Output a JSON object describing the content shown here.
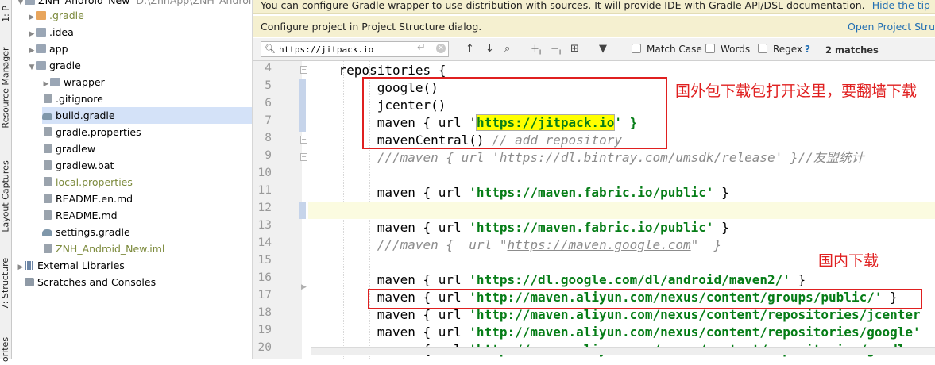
{
  "toolstrip": {
    "tabs": [
      "1: P",
      "Resource Manager",
      "Layout Captures",
      "7: Structure",
      "orites"
    ]
  },
  "project_tree": {
    "root_label": "ZNH_Android_New",
    "root_path": "D:\\ZnhApp\\ZNH_Android",
    "items": [
      {
        "label": ".gradle",
        "kind": "folder-orange",
        "muted": true
      },
      {
        "label": ".idea",
        "kind": "folder"
      },
      {
        "label": "app",
        "kind": "folder"
      },
      {
        "label": "gradle",
        "kind": "folder"
      },
      {
        "label": "wrapper",
        "kind": "folder"
      },
      {
        "label": ".gitignore",
        "kind": "file"
      },
      {
        "label": "build.gradle",
        "kind": "gradle",
        "selected": true
      },
      {
        "label": "gradle.properties",
        "kind": "file"
      },
      {
        "label": "gradlew",
        "kind": "file"
      },
      {
        "label": "gradlew.bat",
        "kind": "file"
      },
      {
        "label": "local.properties",
        "kind": "file",
        "muted": true
      },
      {
        "label": "README.en.md",
        "kind": "file"
      },
      {
        "label": "README.md",
        "kind": "file"
      },
      {
        "label": "settings.gradle",
        "kind": "gradle"
      },
      {
        "label": "ZNH_Android_New.iml",
        "kind": "file",
        "muted": true
      }
    ],
    "external_libraries": "External Libraries",
    "scratches": "Scratches and Consoles"
  },
  "banners": {
    "wrapper_text": "You can configure Gradle wrapper to use distribution with sources. It will provide IDE with Gradle API/DSL documentation.",
    "hide_tip": "Hide the tip",
    "configure_text": "Configure project in Project Structure dialog.",
    "open_structure": "Open Project Stru"
  },
  "search": {
    "value": "https://jitpack.io",
    "enter_glyph": "↵",
    "match_case": "Match Case",
    "words": "Words",
    "regex": "Regex",
    "help": "?",
    "matches": "2 matches"
  },
  "editor": {
    "line_numbers": [
      "4",
      "5",
      "6",
      "7",
      "8",
      "9",
      "10",
      "11",
      "12",
      "13",
      "14",
      "15",
      "16",
      "17",
      "18",
      "19",
      "20"
    ],
    "lines": {
      "l4": "repositories {",
      "l5": "google()",
      "l6": "jcenter()",
      "l7_a": "maven { url '",
      "l7_match": "https://jitpack.io",
      "l7_b": "' }",
      "l8_a": "mavenCentral() ",
      "l8_cmt": "// add repository",
      "l9_a": "///maven { url '",
      "l9_url": "https://dl.bintray.com/umsdk/release",
      "l9_b": "' }//友盟统计",
      "l11_a": "maven { url ",
      "l11_str": "'https://maven.fabric.io/public'",
      "l11_b": " }",
      "l13_a": "maven { url ",
      "l13_str": "'https://maven.fabric.io/public'",
      "l13_b": " }",
      "l14_a": "///maven {  url \"",
      "l14_url": "https://maven.google.com",
      "l14_b": "\"  }",
      "l16_a": "maven { url ",
      "l16_str": "'https://dl.google.com/dl/android/maven2/'",
      "l16_b": " }",
      "l17_a": "maven { url ",
      "l17_str": "'http://maven.aliyun.com/nexus/content/groups/public/'",
      "l17_b": " }",
      "l18_a": "maven { url ",
      "l18_str": "'http://maven.aliyun.com/nexus/content/repositories/jcenter",
      "l19_a": "maven { url ",
      "l19_str": "'http://maven.aliyun.com/nexus/content/repositories/google'",
      "l20_a": "maven { url ",
      "l20_str": "'http://maven.aliyun.com/nexus/content/repositories/gradle-"
    },
    "annotation_foreign": "国外包下载包打开这里，要翻墙下载",
    "annotation_domestic": "国内下载",
    "annotation_color": "#e02020"
  }
}
